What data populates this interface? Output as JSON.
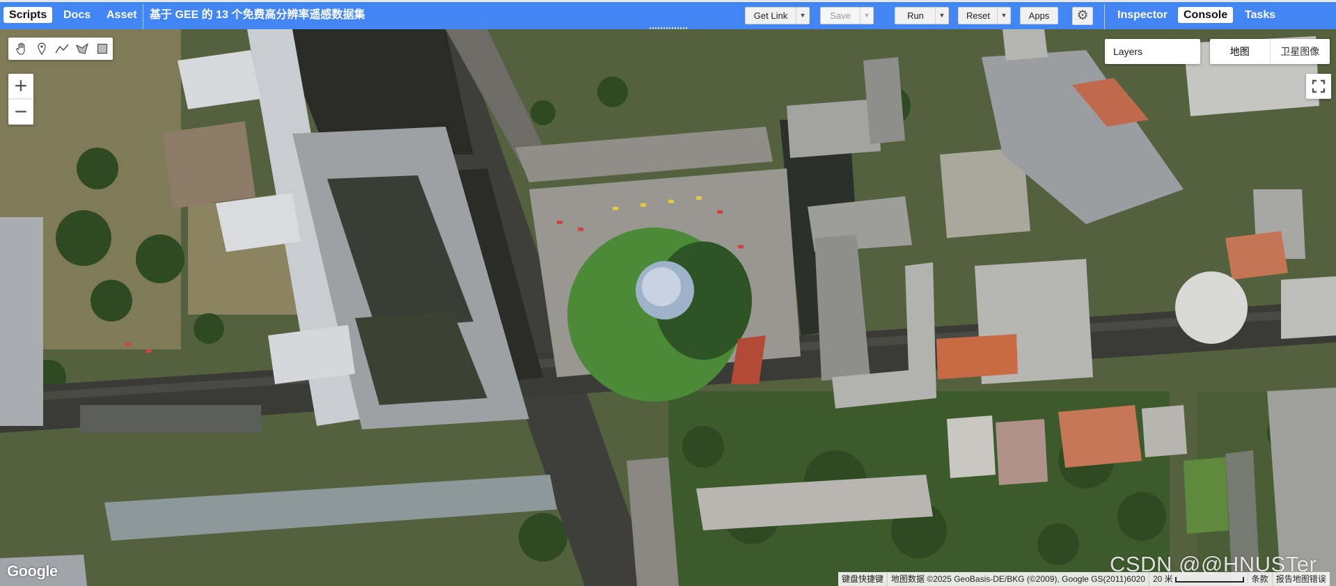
{
  "top_bar": {
    "left_tabs": [
      {
        "label": "Scripts",
        "active": true
      },
      {
        "label": "Docs",
        "active": false
      },
      {
        "label": "Asset",
        "active": false
      }
    ],
    "script_title": "基于 GEE 的 13 个免费高分辨率遥感数据集",
    "buttons": {
      "get_link": "Get Link",
      "save": "Save",
      "run": "Run",
      "reset": "Reset",
      "apps": "Apps"
    },
    "right_tabs": [
      {
        "label": "Inspector",
        "active": false
      },
      {
        "label": "Console",
        "active": true
      },
      {
        "label": "Tasks",
        "active": false
      }
    ],
    "icons": {
      "settings": "gear-icon",
      "dropdown": "caret-down-icon"
    },
    "accent_color": "#4285f4"
  },
  "map": {
    "layers_label": "Layers",
    "map_type_options": [
      "地图",
      "卫星图像"
    ],
    "selected_map_type": "卫星图像",
    "zoom_in": "+",
    "zoom_out": "−",
    "drawing_tools": [
      "hand-icon",
      "marker-icon",
      "line-icon",
      "polygon-icon",
      "rectangle-icon"
    ],
    "logo": "Google",
    "attribution": {
      "shortcuts": "键盘快捷键",
      "data": "地图数据 ©2025 GeoBasis-DE/BKG (©2009), Google GS(2011)6020",
      "scale": "20 米",
      "terms": "条款",
      "report": "报告地图错误"
    },
    "watermark": "CSDN @@HNUSTer"
  }
}
